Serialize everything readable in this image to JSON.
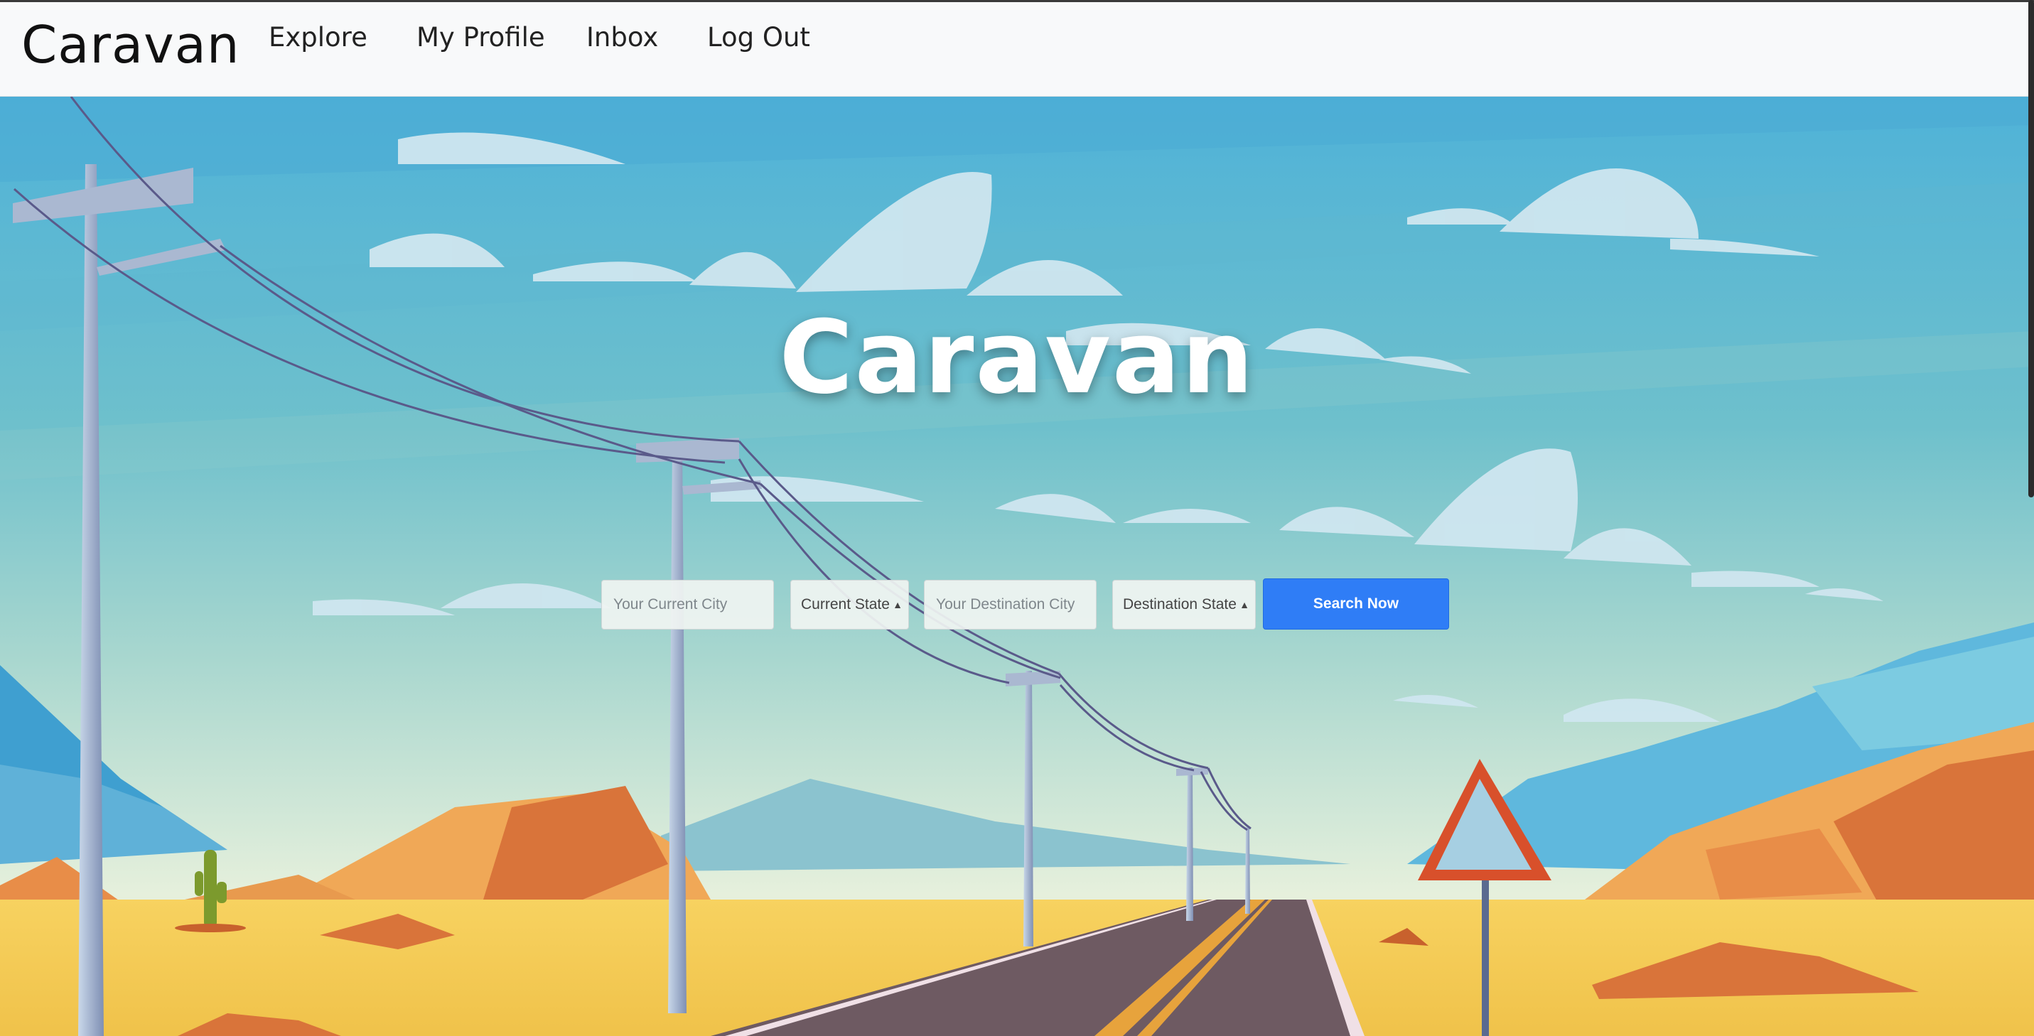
{
  "navbar": {
    "brand": "Caravan",
    "links": [
      "Explore",
      "My Profile",
      "Inbox",
      "Log Out"
    ]
  },
  "hero": {
    "title": "Caravan",
    "illustration": "desert-road-with-power-lines"
  },
  "search": {
    "current_city_placeholder": "Your Current City",
    "current_state_label": "Current State",
    "destination_city_placeholder": "Your Destination City",
    "destination_state_label": "Destination State",
    "submit_label": "Search Now"
  },
  "colors": {
    "sky_top": "#4fb2d8",
    "sky_bottom": "#e8f1dc",
    "sand": "#f5cf58",
    "rock": "#e79a4f",
    "road": "#6e5a62",
    "button": "#2f7df6"
  }
}
